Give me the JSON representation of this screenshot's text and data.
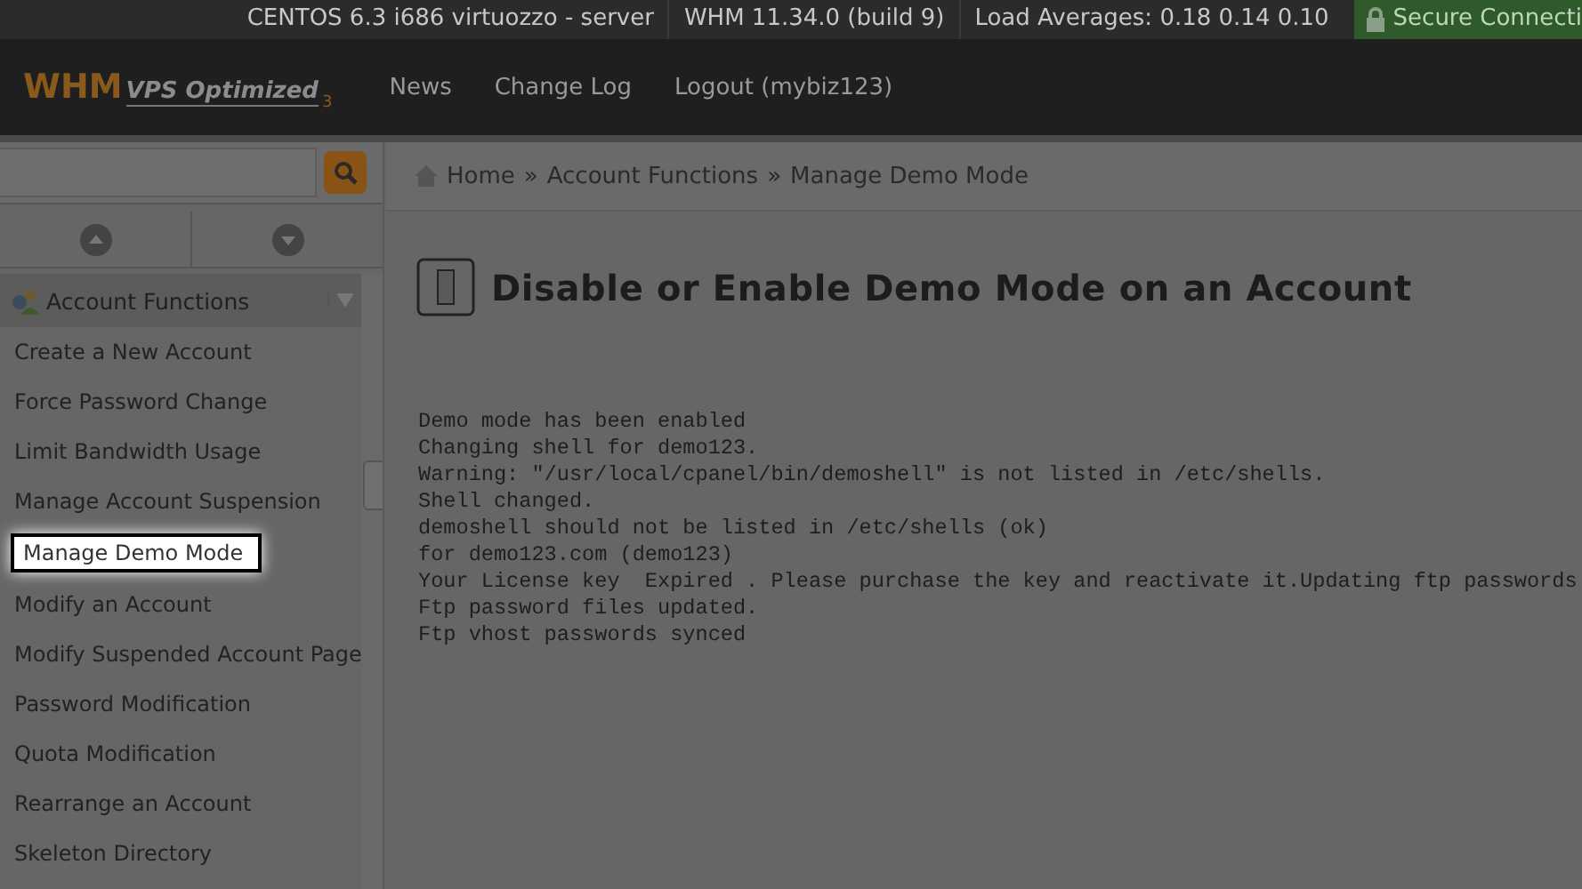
{
  "status_bar": {
    "items": [
      "CENTOS 6.3 i686 virtuozzo - server",
      "WHM 11.34.0 (build 9)",
      "Load Averages: 0.18 0.14 0.10"
    ],
    "secure": "Secure Connecti"
  },
  "header": {
    "logo": "WHM",
    "logo_sub": "VPS Optimized",
    "logo_mark": "3",
    "nav": [
      "News",
      "Change Log",
      "Logout (mybiz123)"
    ]
  },
  "sidebar": {
    "section": {
      "title": "Account Functions",
      "expanded": true
    },
    "items": [
      {
        "label": "Create a New Account",
        "selected": false
      },
      {
        "label": "Force Password Change",
        "selected": false
      },
      {
        "label": "Limit Bandwidth Usage",
        "selected": false
      },
      {
        "label": "Manage Account Suspension",
        "selected": false
      },
      {
        "label": "Manage Demo Mode",
        "selected": true
      },
      {
        "label": "Modify an Account",
        "selected": false
      },
      {
        "label": "Modify Suspended Account Page",
        "selected": false
      },
      {
        "label": "Password Modification",
        "selected": false
      },
      {
        "label": "Quota Modification",
        "selected": false
      },
      {
        "label": "Rearrange an Account",
        "selected": false
      },
      {
        "label": "Skeleton Directory",
        "selected": false
      }
    ]
  },
  "breadcrumb": [
    "Home",
    "»",
    "Account Functions",
    "»",
    "Manage Demo Mode"
  ],
  "page": {
    "title": "Disable or Enable Demo Mode on an Account",
    "output": [
      "Demo mode has been enabled",
      "Changing shell for demo123.",
      "Warning: \"/usr/local/cpanel/bin/demoshell\" is not listed in /etc/shells.",
      "Shell changed.",
      "demoshell should not be listed in /etc/shells (ok)",
      "for demo123.com (demo123)",
      "Your License key  Expired . Please purchase the key and reactivate it.Updating ftp passwords",
      "Ftp password files updated.",
      "Ftp vhost passwords synced"
    ]
  }
}
